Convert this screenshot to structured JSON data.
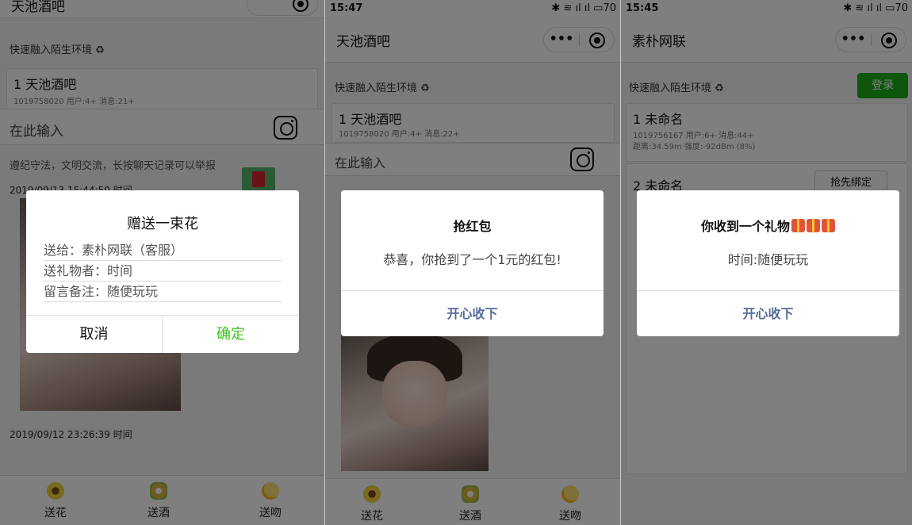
{
  "panel1": {
    "title": "天池酒吧",
    "fast_join": "快速融入陌生环境 ♻",
    "room": {
      "name": "1 天池酒吧",
      "meta": "1019758020 用户:4+ 消息:21+"
    },
    "input_placeholder": "在此输入",
    "rules": "遵纪守法，文明交流，长按聊天记录可以举报",
    "entries": [
      "2019/09/13 15:44:50 时间",
      "2019/09/12 23:26:39 时间"
    ],
    "dialog": {
      "title": "赠送一束花",
      "to": "送给：素朴网联（客服）",
      "sender": "送礼物者：时间",
      "note": "留言备注：随便玩玩",
      "cancel": "取消",
      "ok": "确定"
    },
    "tabs": [
      {
        "label": "送花",
        "icon": "flower-icon"
      },
      {
        "label": "送酒",
        "icon": "wine-icon"
      },
      {
        "label": "送吻",
        "icon": "kiss-icon"
      }
    ]
  },
  "panel2": {
    "status": {
      "time": "15:47",
      "icons": "✱ ≋ ıl ıl ▭70"
    },
    "title": "天池酒吧",
    "fast_join": "快速融入陌生环境 ♻",
    "room": {
      "name": "1 天池酒吧",
      "meta": "1019758020 用户:4+ 消息:22+"
    },
    "input_placeholder": "在此输入",
    "dialog": {
      "title": "抢红包",
      "message": "恭喜，你抢到了一个1元的红包!",
      "button": "开心收下"
    },
    "tabs": [
      {
        "label": "送花",
        "icon": "flower-icon"
      },
      {
        "label": "送酒",
        "icon": "wine-icon"
      },
      {
        "label": "送吻",
        "icon": "kiss-icon"
      }
    ]
  },
  "panel3": {
    "status": {
      "time": "15:45",
      "icons": "✱ ≋ ıl ıl ▭70"
    },
    "title": "素朴网联",
    "fast_join": "快速融入陌生环境 ♻",
    "login": "登录",
    "rooms": [
      {
        "name": "1 未命名",
        "meta1": "1019756167 用户:6+ 消息:44+",
        "meta2": "距离:34.59m 强度:-92dBm (8%)"
      },
      {
        "name": "2 未命名",
        "meta1": "",
        "meta2": ""
      }
    ],
    "bind_button": "抢先绑定",
    "dialog": {
      "title": "你收到一个礼物",
      "message": "时间:随便玩玩",
      "button": "开心收下"
    }
  }
}
